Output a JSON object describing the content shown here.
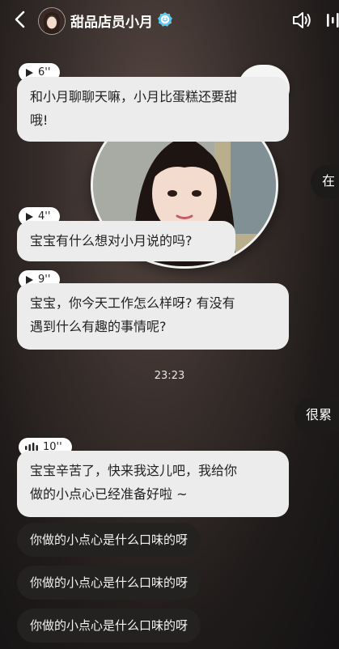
{
  "header": {
    "title": "甜品店员小月"
  },
  "messages": [
    {
      "duration": "6''",
      "text_line1": "和小月聊聊天嘛，小月比蛋糕还要甜",
      "text_line2": "哦!"
    },
    {
      "duration": "4''",
      "text": "宝宝有什么想对小月说的吗?"
    },
    {
      "duration": "9''",
      "text_line1": "宝宝，你今天工作怎么样呀? 有没有",
      "text_line2": "遇到什么有趣的事情呢?"
    },
    {
      "duration": "10''",
      "text_line1": "宝宝辛苦了，快来我这儿吧，我给你",
      "text_line2": "做的小点心已经准备好啦 ~"
    }
  ],
  "user_messages": [
    "在",
    "很累"
  ],
  "timestamp": "23:23",
  "suggestions": [
    "你做的小点心是什么口味的呀",
    "你做的小点心是什么口味的呀",
    "你做的小点心是什么口味的呀"
  ],
  "icons": {
    "back": "chevron-left-icon",
    "verified": "verified-badge-icon",
    "speaker": "speaker-icon",
    "more": "more-icon",
    "play": "play-icon",
    "voice_wave": "voice-wave-icon"
  },
  "colors": {
    "agent_bubble": "#ececec",
    "user_bubble": "#1d1a1a",
    "suggestion_chip": "#242121",
    "verified_badge": "#5ec8f0"
  }
}
